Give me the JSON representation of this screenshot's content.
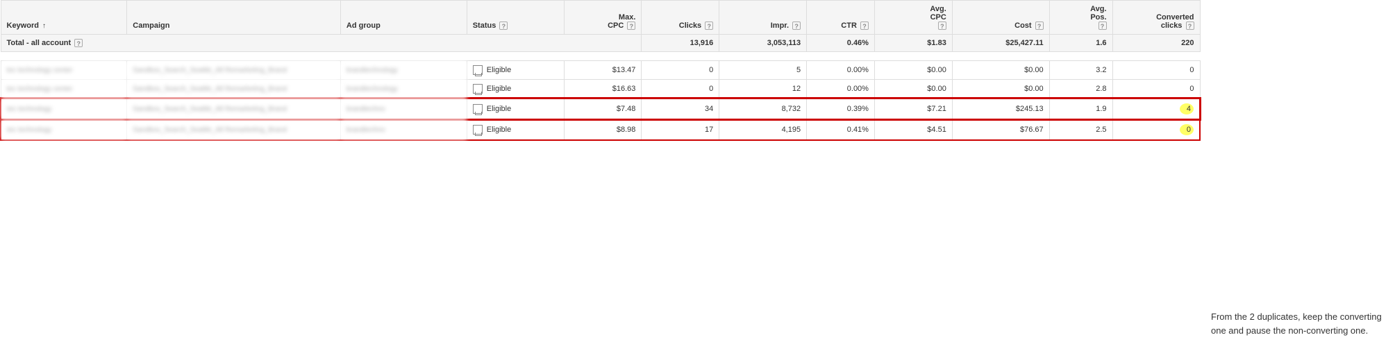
{
  "table": {
    "headers": {
      "keyword": "Keyword",
      "campaign": "Campaign",
      "adgroup": "Ad group",
      "status": "Status",
      "maxcpc_line1": "Max.",
      "maxcpc_line2": "CPC",
      "clicks": "Clicks",
      "impr": "Impr.",
      "ctr": "CTR",
      "avgcpc_line1": "Avg.",
      "avgcpc_line2": "CPC",
      "cost": "Cost",
      "avgpos_line1": "Avg.",
      "avgpos_line2": "Pos.",
      "converted_line1": "Converted",
      "converted_line2": "clicks"
    },
    "total": {
      "label": "Total - all account",
      "clicks": "13,916",
      "impr": "3,053,113",
      "ctr": "0.46%",
      "avgcpc": "$1.83",
      "cost": "$25,427.11",
      "avgpos": "1.6",
      "converted": "220"
    },
    "rows": [
      {
        "keyword": "tec technology center",
        "campaign": "Sandbox_Search_Seattle_All Remarketing_Brand",
        "adgroup": "brandtechnology",
        "status": "Eligible",
        "maxcpc": "$13.47",
        "clicks": "0",
        "impr": "5",
        "ctr": "0.00%",
        "avgcpc": "$0.00",
        "cost": "$0.00",
        "avgpos": "3.2",
        "converted": "0"
      },
      {
        "keyword": "tec technology center",
        "campaign": "Sandbox_Search_Seattle_All Remarketing_Brand",
        "adgroup": "brandtechnology",
        "status": "Eligible",
        "maxcpc": "$16.63",
        "clicks": "0",
        "impr": "12",
        "ctr": "0.00%",
        "avgcpc": "$0.00",
        "cost": "$0.00",
        "avgpos": "2.8",
        "converted": "0"
      },
      {
        "keyword": "tec technology",
        "campaign": "Sandbox_Search_Seattle_All Remarketing_Brand",
        "adgroup": "brandtechno",
        "status": "Eligible",
        "maxcpc": "$7.48",
        "clicks": "34",
        "impr": "8,732",
        "ctr": "0.39%",
        "avgcpc": "$7.21",
        "cost": "$245.13",
        "avgpos": "1.9",
        "converted": "4"
      },
      {
        "keyword": "tec technology",
        "campaign": "Sandbox_Search_Seattle_All Remarketing_Brand",
        "adgroup": "brandtechno",
        "status": "Eligible",
        "maxcpc": "$8.98",
        "clicks": "17",
        "impr": "4,195",
        "ctr": "0.41%",
        "avgcpc": "$4.51",
        "cost": "$76.67",
        "avgpos": "2.5",
        "converted": "0"
      }
    ]
  },
  "annotation": {
    "text": "From the 2 duplicates, keep the converting one and pause the non-converting one."
  }
}
